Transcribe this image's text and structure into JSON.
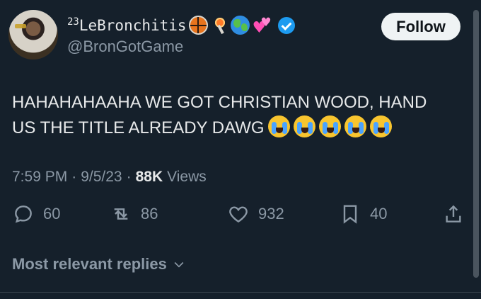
{
  "author": {
    "display_name_prefix": "23",
    "display_name": "LeBronchitis",
    "handle": "@BronGotGame",
    "verified": true,
    "emoji_icons": [
      "basketball-icon",
      "torch-icon",
      "globe-icon",
      "hearts-icon"
    ]
  },
  "follow_button": {
    "label": "Follow"
  },
  "tweet": {
    "line1": "HAHAHAHAAHA WE GOT CHRISTIAN WOOD, HAND",
    "line2": "US THE TITLE ALREADY DAWG",
    "emoji_count": 5,
    "emoji_icon": "loudly-crying-face-icon"
  },
  "meta": {
    "time": "7:59 PM",
    "separator": "·",
    "date": "9/5/23",
    "views_count": "88K",
    "views_label": "Views"
  },
  "actions": {
    "replies": "60",
    "retweets": "86",
    "likes": "932",
    "bookmarks": "40"
  },
  "replies_filter": {
    "label": "Most relevant replies"
  },
  "colors": {
    "background": "#15202b",
    "text": "#e7e9ea",
    "secondary": "#8b98a5",
    "verified": "#1d9bf0"
  }
}
